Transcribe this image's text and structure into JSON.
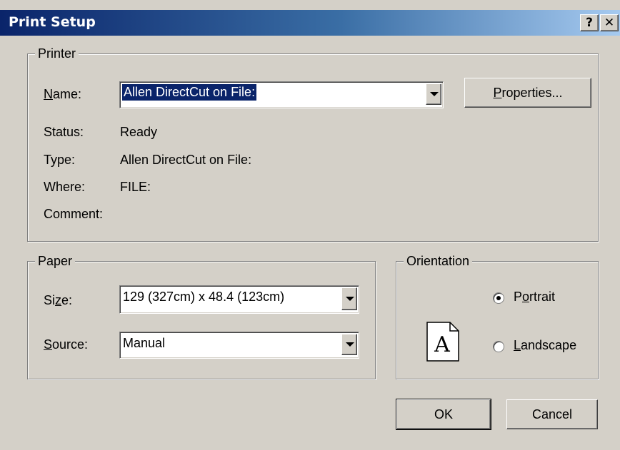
{
  "window": {
    "title": "Print Setup",
    "help_glyph": "?",
    "close_glyph": "✕"
  },
  "printer": {
    "group_label": "Printer",
    "name_label_prefix": "N",
    "name_label_rest": "ame:",
    "name_value": "Allen DirectCut on File:",
    "properties_button_prefix": "P",
    "properties_button_rest": "roperties...",
    "status_label": "Status:",
    "status_value": "Ready",
    "type_label": "Type:",
    "type_value": "Allen DirectCut on File:",
    "where_label": "Where:",
    "where_value": "FILE:",
    "comment_label": "Comment:",
    "comment_value": ""
  },
  "paper": {
    "group_label": "Paper",
    "size_label_prefix": "Si",
    "size_label_ul": "z",
    "size_label_rest": "e:",
    "size_value": "129 (327cm) x  48.4 (123cm)",
    "source_label_ul": "S",
    "source_label_rest": "ource:",
    "source_value": "Manual"
  },
  "orientation": {
    "group_label": "Orientation",
    "page_glyph": "A",
    "portrait_prefix": "P",
    "portrait_ul": "o",
    "portrait_rest": "rtrait",
    "portrait_selected": true,
    "landscape_ul": "L",
    "landscape_rest": "andscape",
    "landscape_selected": false
  },
  "buttons": {
    "ok": "OK",
    "cancel": "Cancel"
  },
  "colors": {
    "dialog_bg": "#d4d0c8",
    "title_start": "#0a246a",
    "title_end": "#a6caf0",
    "selection": "#0a246a"
  }
}
